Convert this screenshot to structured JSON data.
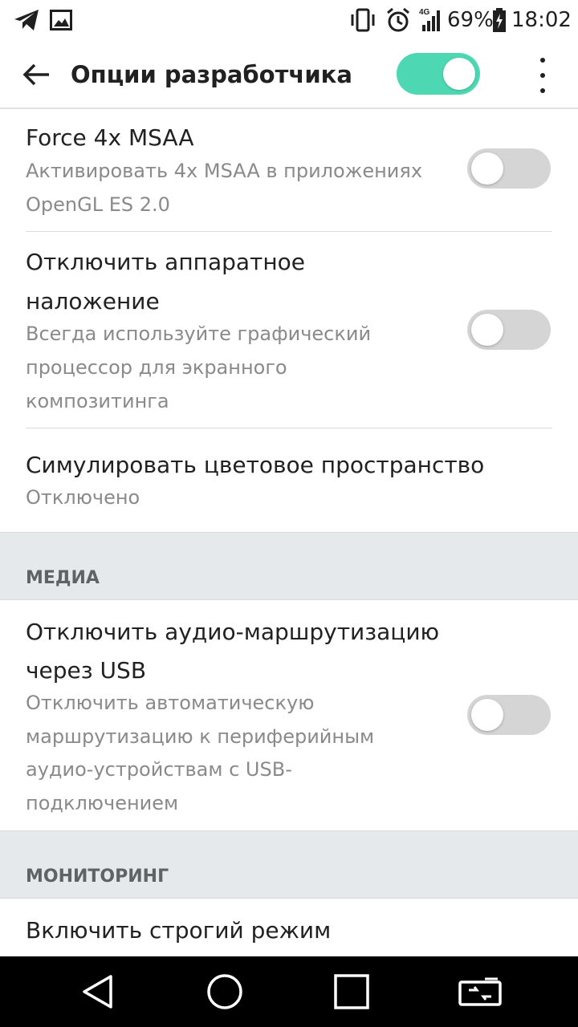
{
  "status_bar": {
    "battery_percent": "69%",
    "time": "18:02",
    "network": "4G",
    "icons": [
      "telegram-icon",
      "gallery-icon",
      "vibrate-icon",
      "alarm-icon",
      "signal-icon",
      "battery-charging-icon"
    ]
  },
  "app_bar": {
    "title": "Опции разработчика",
    "master_toggle_on": true,
    "accent_color": "#4dd8b3"
  },
  "preferences": [
    {
      "title": "Force 4x MSAA",
      "summary": "Активировать 4x MSAA в приложениях OpenGL ES 2.0",
      "summary_lines": [
        "Активировать 4x MSAA в приложениях",
        "OpenGL ES 2.0"
      ],
      "toggle_on": false
    },
    {
      "title": "Отключить аппаратное наложение",
      "title_lines": [
        "Отключить аппаратное",
        "наложение"
      ],
      "summary_lines": [
        "Всегда используйте графический",
        "процессор для экранного",
        "композитинга"
      ],
      "toggle_on": false
    },
    {
      "title": "Симулировать цветовое пространство",
      "summary": "Отключено"
    }
  ],
  "sections": {
    "media": {
      "label": "МЕДИА",
      "items": [
        {
          "title_lines": [
            "Отключить аудио-маршрутизацию",
            "через USB"
          ],
          "summary_lines": [
            "Отключить автоматическую",
            "маршрутизацию к периферийным",
            "аудио-устройствам с USB-",
            "подключением"
          ],
          "toggle_on": false
        }
      ]
    },
    "monitoring": {
      "label": "МОНИТОРИНГ",
      "items": [
        {
          "title": "Включить строгий режим"
        }
      ]
    }
  },
  "nav_bar": {
    "buttons": [
      "back-triangle-icon",
      "home-circle-icon",
      "recents-square-icon",
      "dual-window-icon"
    ]
  }
}
